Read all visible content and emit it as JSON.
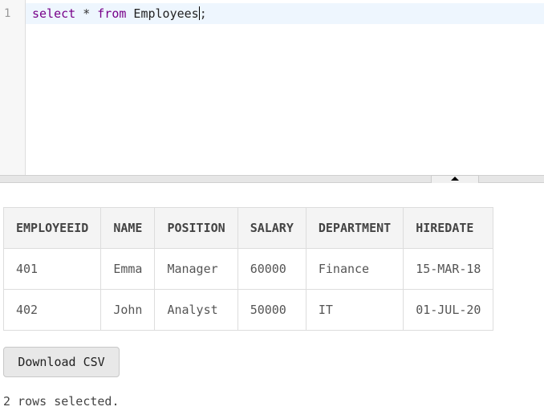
{
  "editor": {
    "line_number": "1",
    "code": {
      "kw_select": "select",
      "star": " * ",
      "kw_from": "from",
      "table": " Employees",
      "terminator": ";"
    }
  },
  "results": {
    "columns": [
      "EMPLOYEEID",
      "NAME",
      "POSITION",
      "SALARY",
      "DEPARTMENT",
      "HIREDATE"
    ],
    "rows": [
      [
        "401",
        "Emma",
        "Manager",
        "60000",
        "Finance",
        "15-MAR-18"
      ],
      [
        "402",
        "John",
        "Analyst",
        "50000",
        "IT",
        "01-JUL-20"
      ]
    ]
  },
  "actions": {
    "download_label": "Download CSV"
  },
  "status": {
    "text": "2 rows selected."
  },
  "icons": {
    "splitter_toggle": "caret-up-icon"
  },
  "colors": {
    "keyword": "#770088",
    "active_line": "#eef6fe"
  }
}
